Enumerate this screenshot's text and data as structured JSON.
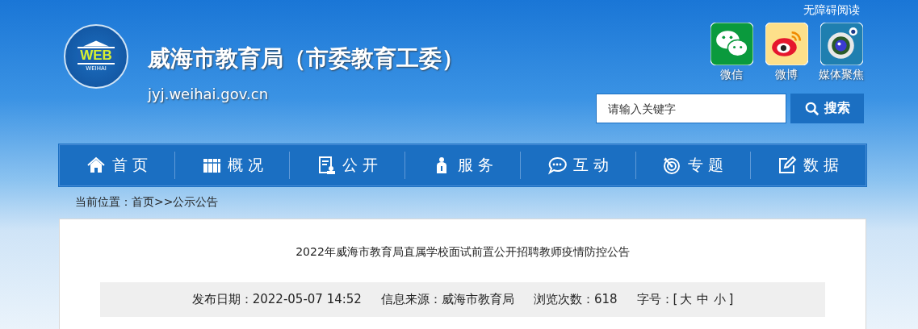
{
  "header": {
    "site_title": "威海市教育局（市委教育工委）",
    "site_url": "jyj.weihai.gov.cn",
    "logo_text": "WEB",
    "logo_caption": "WEIHAI",
    "accessibility_link": "无障碍阅读",
    "social": [
      {
        "kind": "wechat",
        "label": "微信"
      },
      {
        "kind": "weibo",
        "label": "微博"
      },
      {
        "kind": "media",
        "label": "媒体聚焦"
      }
    ],
    "search": {
      "placeholder": "请输入关键字",
      "button": "搜索"
    }
  },
  "nav": [
    {
      "kind": "home",
      "label": "首 页"
    },
    {
      "kind": "overview",
      "label": "概 况"
    },
    {
      "kind": "open",
      "label": "公 开"
    },
    {
      "kind": "service",
      "label": "服 务"
    },
    {
      "kind": "interact",
      "label": "互 动"
    },
    {
      "kind": "topic",
      "label": "专 题"
    },
    {
      "kind": "data",
      "label": "数 据"
    }
  ],
  "breadcrumb": {
    "label": "当前位置：",
    "links": [
      "首页",
      ">>公示公告"
    ]
  },
  "article": {
    "title": "2022年威海市教育局直属学校面试前置公开招聘教师疫情防控公告",
    "meta": [
      {
        "label": "发布日期：",
        "value": "2022-05-07 14:52"
      },
      {
        "label": "信息来源：",
        "value": "威海市教育局"
      },
      {
        "label": "浏览次数：",
        "value": "618"
      }
    ],
    "font_size": {
      "label": "字号：[",
      "options": [
        "大",
        "中",
        "小"
      ],
      "close": "]"
    }
  }
}
